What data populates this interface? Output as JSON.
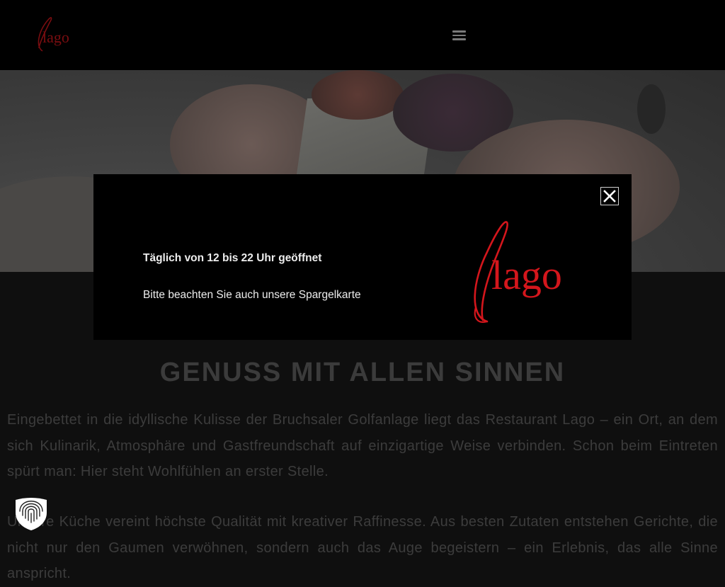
{
  "header": {
    "logo_text": "lago",
    "menu_icon": "hamburger-menu-icon"
  },
  "content": {
    "title": "GENUSS MIT ALLEN SINNEN",
    "paragraph_1": "Eingebettet in die idyllische Kulisse der Bruchsaler Golfanlage liegt das Restaurant Lago – ein Ort, an dem sich Kulinarik, Atmosphäre und Gastfreundschaft auf einzigartige Weise verbinden. Schon beim Eintreten spürt man: Hier steht Wohlfühlen an erster Stelle.",
    "paragraph_2": "Unsere Küche vereint höchste Qualität mit kreativer Raffinesse. Aus besten Zutaten entstehen Gerichte, die nicht nur den Gaumen verwöhnen, sondern auch das Auge begeistern – ein Erlebnis, das alle Sinne anspricht."
  },
  "modal": {
    "hours_text": "Täglich von 12 bis 22 Uhr geöffnet",
    "note_text": "Bitte beachten Sie auch unsere Spargelkarte",
    "logo_text": "lago",
    "close_icon": "close-icon"
  },
  "privacy_badge": {
    "icon": "fingerprint-shield-icon"
  },
  "colors": {
    "brand_red": "#d4161c",
    "modal_bg": "#000000",
    "overlay_text": "#3c3c3c"
  }
}
